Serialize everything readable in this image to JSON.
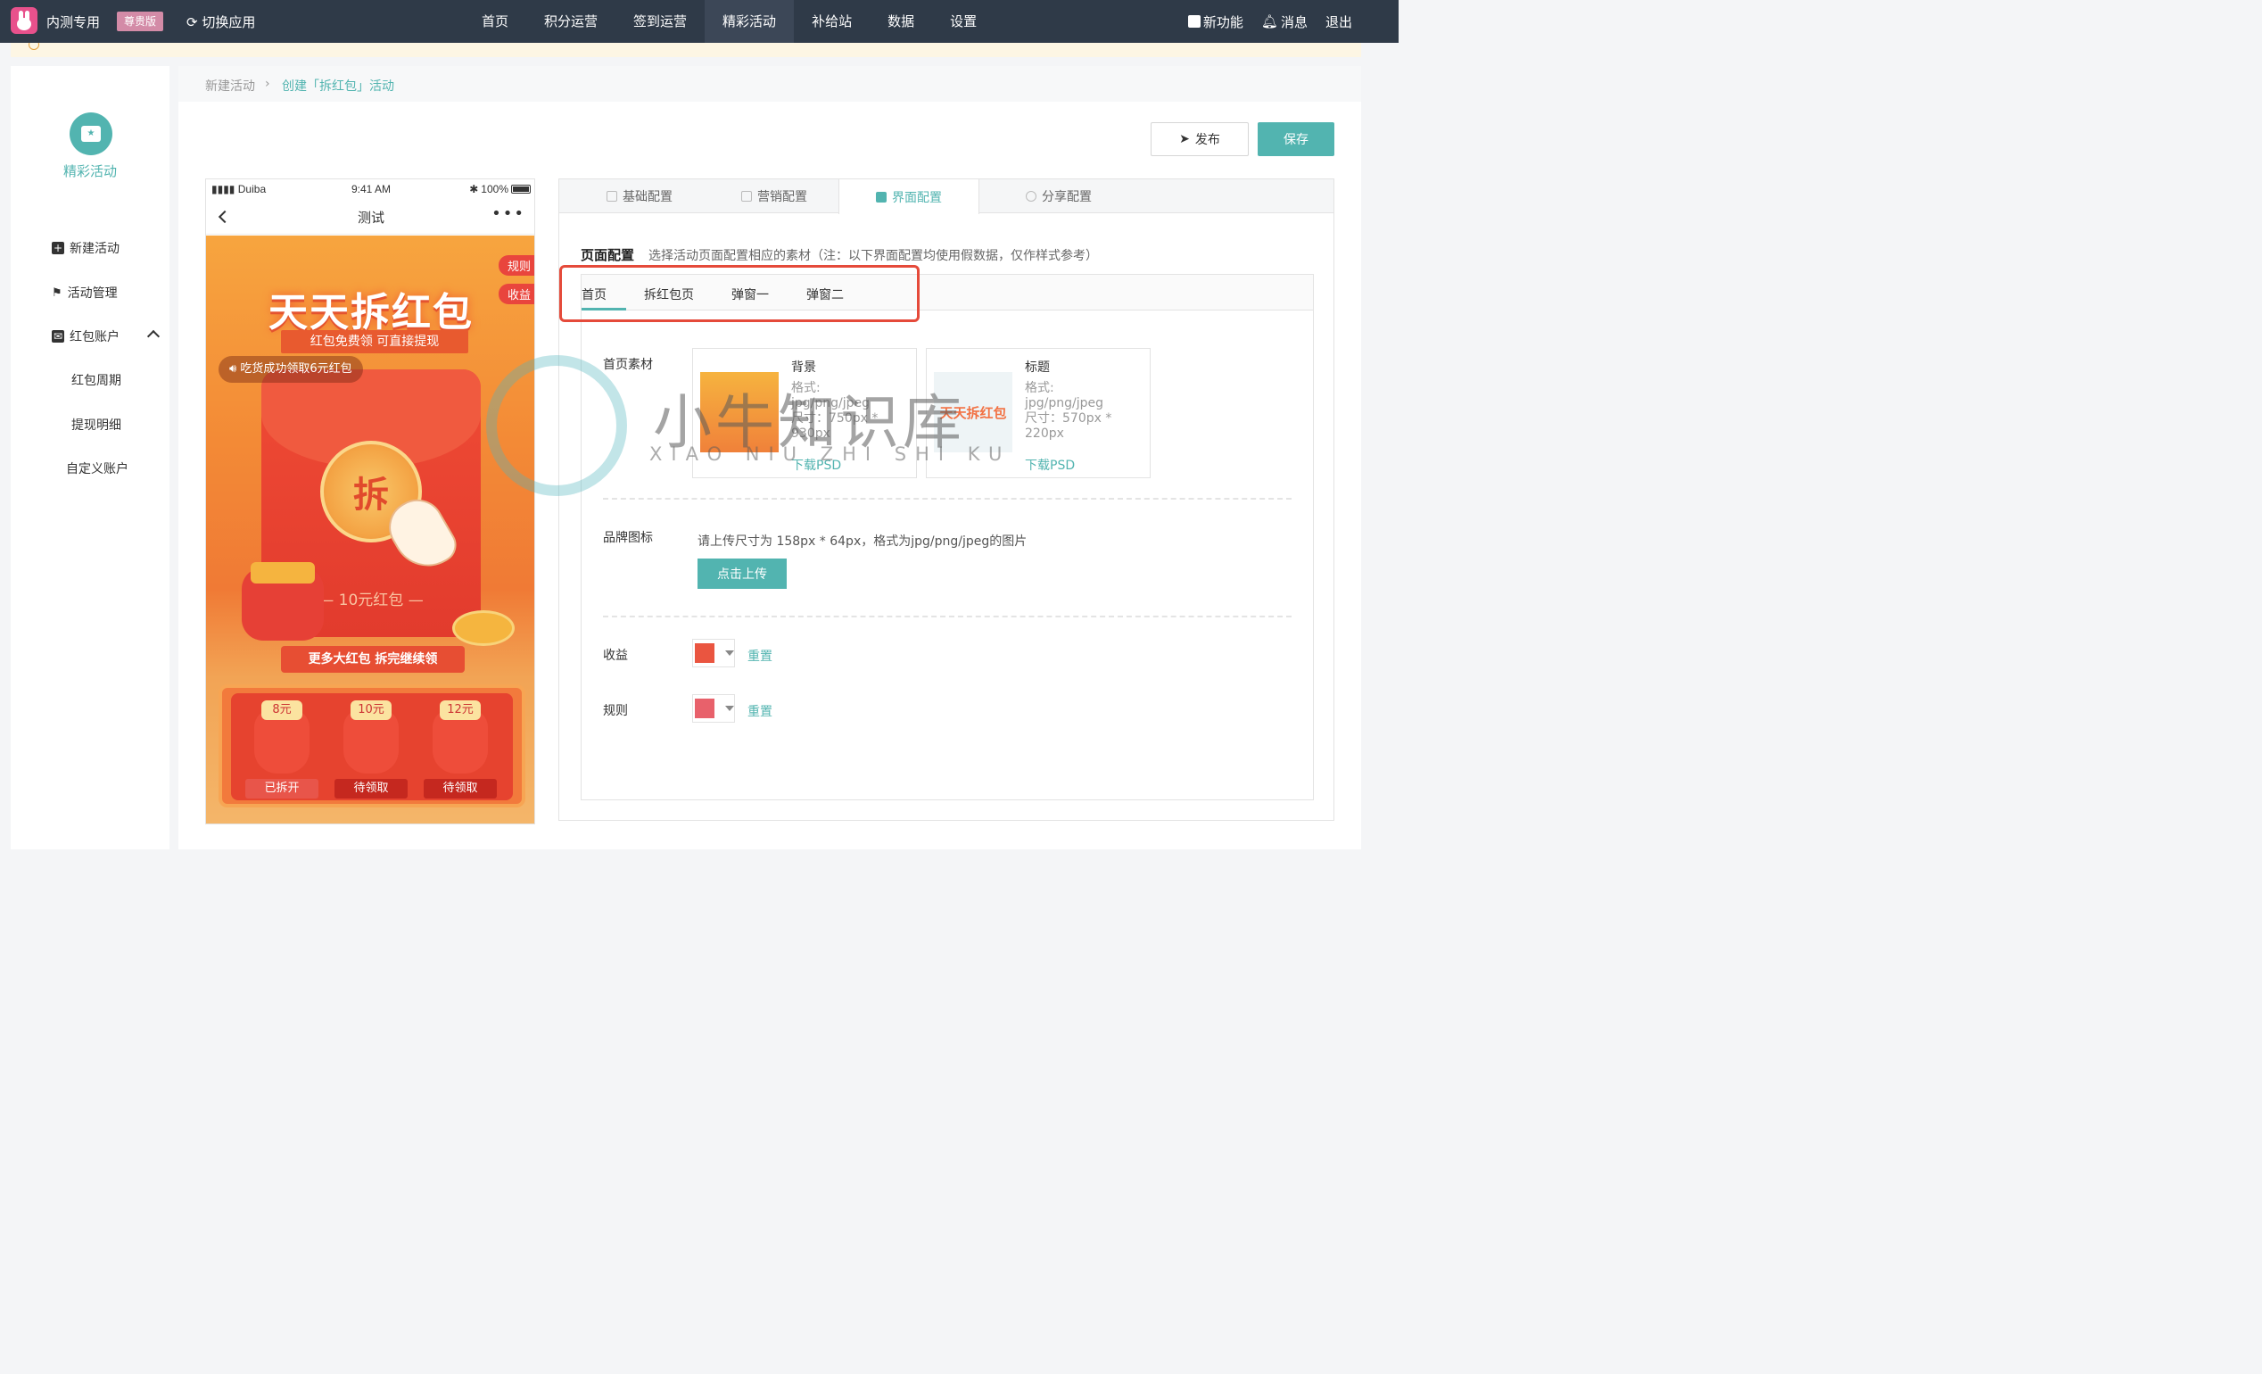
{
  "topbar": {
    "app_name": "内测专用",
    "vip_badge": "尊贵版",
    "switch_app": "切换应用",
    "nav": [
      "首页",
      "积分运营",
      "签到运营",
      "精彩活动",
      "补给站",
      "数据",
      "设置"
    ],
    "active_nav": "精彩活动",
    "new_feature": "新功能",
    "messages": "消息",
    "logout": "退出"
  },
  "sidebar": {
    "title": "精彩活动",
    "items": [
      "新建活动",
      "活动管理",
      "红包账户"
    ],
    "sub_items": [
      "红包周期",
      "提现明细",
      "自定义账户"
    ]
  },
  "breadcrumb": {
    "home": "新建活动",
    "current": "创建「拆红包」活动"
  },
  "actions": {
    "publish": "发布",
    "save": "保存"
  },
  "phone": {
    "carrier": "Duiba",
    "time": "9:41 AM",
    "battery": "100%",
    "title": "测试",
    "rules": "规则",
    "income": "收益",
    "banner_title": "天天拆红包",
    "banner_sub": "红包免费领  可直接提现",
    "marquee": "吃货成功领取6元红包",
    "open_char": "拆",
    "amount": "— 10元红包 —",
    "cta": "更多大红包 拆完继续领",
    "rewards": [
      {
        "amount": "8元",
        "status": "已拆开"
      },
      {
        "amount": "10元",
        "status": "待领取"
      },
      {
        "amount": "12元",
        "status": "待领取"
      }
    ]
  },
  "config": {
    "tabs": [
      "基础配置",
      "营销配置",
      "界面配置",
      "分享配置"
    ],
    "active_tab": "界面配置",
    "section_title": "页面配置",
    "section_desc": "选择活动页面配置相应的素材（注：以下界面配置均使用假数据，仅作样式参考）",
    "sub_tabs": [
      "首页",
      "拆红包页",
      "弹窗一",
      "弹窗二"
    ],
    "active_sub_tab": "首页",
    "assets_label": "首页素材",
    "assets": [
      {
        "name": "背景",
        "format": "格式:",
        "format_value": "jpg/png/jpeg",
        "size": "尺寸：750px *",
        "size2": "930px",
        "link": "下载PSD",
        "thumb": ""
      },
      {
        "name": "标题",
        "format": "格式:",
        "format_value": "jpg/png/jpeg",
        "size": "尺寸：570px *",
        "size2": "220px",
        "link": "下载PSD",
        "thumb": "天天拆红包"
      }
    ],
    "brand_label": "品牌图标",
    "brand_hint": "请上传尺寸为 158px * 64px，格式为jpg/png/jpeg的图片",
    "upload_btn": "点击上传",
    "income_label": "收益",
    "income_color": "#ea5540",
    "rules_label": "规则",
    "rules_color": "#e8616b",
    "reset": "重置"
  },
  "watermark": {
    "text": "小牛知识库",
    "sub": "XIAO NIU ZHI SHI KU"
  }
}
